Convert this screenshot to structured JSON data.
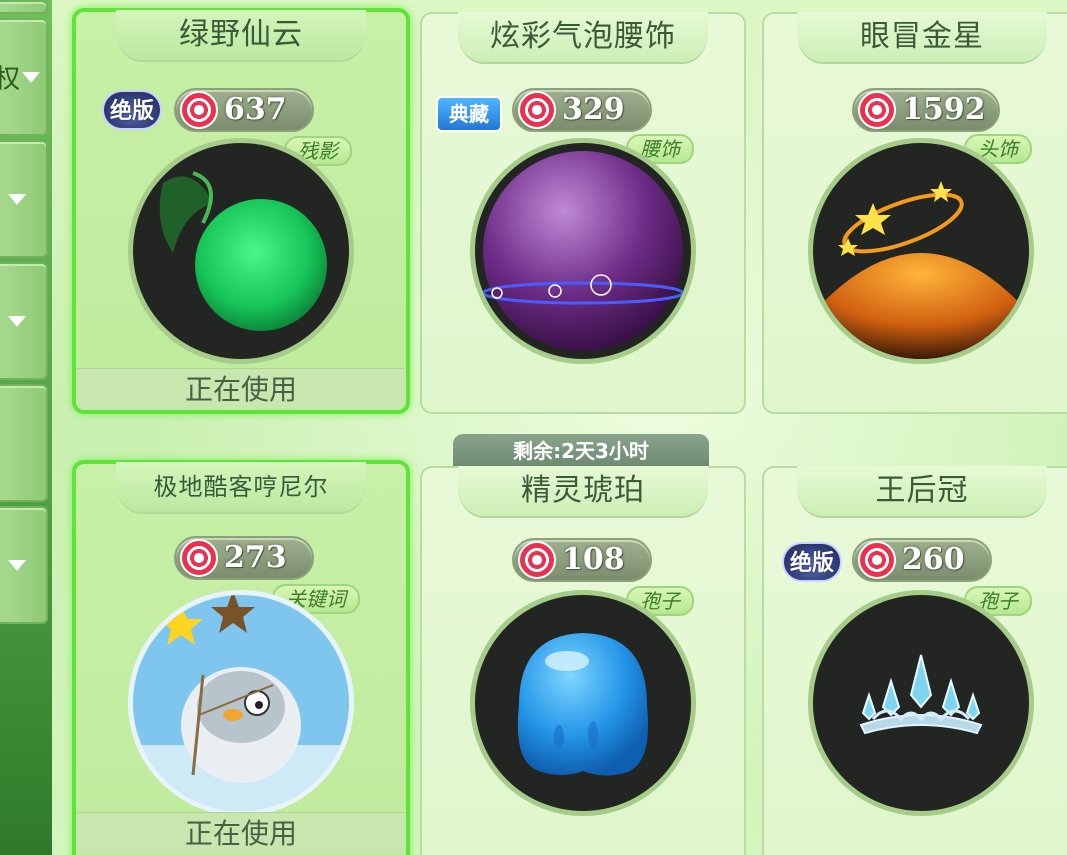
{
  "sidebar": {
    "tabs": [
      {
        "text": "权"
      },
      {
        "text": ""
      },
      {
        "text": ""
      },
      {
        "text": ""
      },
      {
        "text": ""
      }
    ]
  },
  "timer": {
    "label": "剩余:2天3小时"
  },
  "items": [
    {
      "name": "绿野仙云",
      "price": "637",
      "tag": "残影",
      "badge": "绝版",
      "status": "正在使用",
      "selected": true,
      "color": "#2ee86a"
    },
    {
      "name": "炫彩气泡腰饰",
      "price": "329",
      "tag": "腰饰",
      "badge": "典藏",
      "status": "",
      "selected": false,
      "color": "#9b4fc4"
    },
    {
      "name": "眼冒金星",
      "price": "1592",
      "tag": "头饰",
      "badge": "",
      "status": "",
      "selected": false,
      "color": "#ff9a1f"
    },
    {
      "name": "极地酷客哼尼尔",
      "price": "273",
      "tag": "关键词",
      "badge": "",
      "status": "正在使用",
      "selected": true,
      "color": "#7fd0f5"
    },
    {
      "name": "精灵琥珀",
      "price": "108",
      "tag": "孢子",
      "badge": "",
      "status": "",
      "selected": false,
      "color": "#2fa6f2"
    },
    {
      "name": "王后冠",
      "price": "260",
      "tag": "孢子",
      "badge": "绝版",
      "status": "",
      "selected": false,
      "color": "#9fd8ef"
    }
  ],
  "icons": {
    "currency": "candy-icon",
    "dropdown": "triangle-down-icon"
  }
}
